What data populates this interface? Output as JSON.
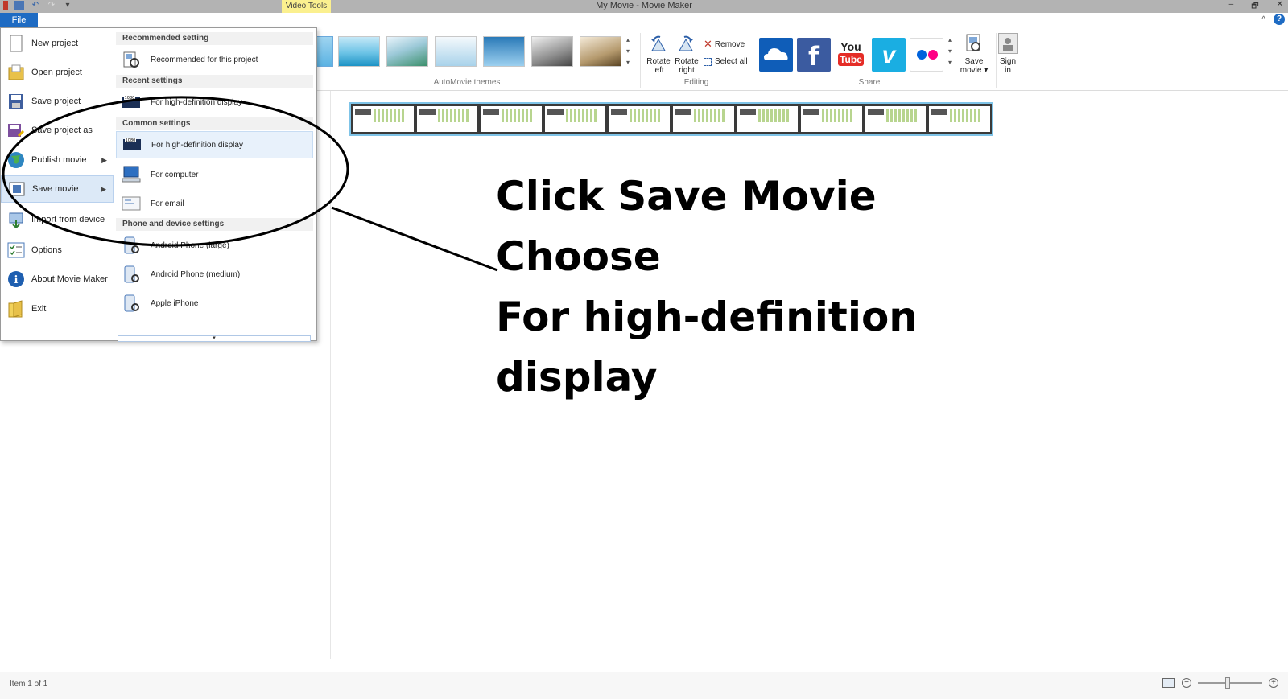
{
  "window": {
    "title": "My Movie - Movie Maker",
    "context_tab": "Video Tools",
    "file_tab": "File",
    "controls": [
      "–",
      "🗗",
      "✕"
    ]
  },
  "ribbon": {
    "groups": {
      "automovie_themes": "AutoMovie themes",
      "editing": "Editing",
      "share": "Share"
    },
    "editing": {
      "rotate_left": "Rotate left",
      "rotate_right": "Rotate right",
      "remove": "Remove",
      "select_all": "Select all"
    },
    "share_services": [
      "OneDrive",
      "Facebook",
      "YouTube",
      "Vimeo",
      "Flickr"
    ],
    "youtube_top": "You",
    "youtube_bottom": "Tube",
    "save_movie": "Save movie",
    "sign_in": "Sign in",
    "colors": {
      "onedrive": "#0f5db8",
      "facebook": "#3b5ba0",
      "youtube": "#e52d27",
      "vimeo": "#1aaee2",
      "flickr_blue": "#0063dc",
      "flickr_pink": "#ff0084"
    }
  },
  "file_menu": {
    "items": [
      {
        "label": "New project",
        "icon": "new-project-icon"
      },
      {
        "label": "Open project",
        "icon": "open-folder-icon"
      },
      {
        "label": "Save project",
        "icon": "save-disk-icon"
      },
      {
        "label": "Save project as",
        "icon": "save-as-icon"
      },
      {
        "label": "Publish movie",
        "icon": "globe-icon"
      },
      {
        "label": "Save movie",
        "icon": "film-icon"
      },
      {
        "label": "Import from device",
        "icon": "import-device-icon"
      },
      {
        "label": "Options",
        "icon": "options-checklist-icon"
      },
      {
        "label": "About Movie Maker",
        "icon": "info-icon"
      },
      {
        "label": "Exit",
        "icon": "exit-folder-icon"
      }
    ],
    "save_submenu": {
      "sections": {
        "recommended": "Recommended setting",
        "recent": "Recent settings",
        "common": "Common settings",
        "phone": "Phone and device settings"
      },
      "options": {
        "recommended": "Recommended for this project",
        "recent_hd": "For high-definition display",
        "hd": "For high-definition display",
        "computer": "For computer",
        "email": "For email",
        "android_large": "Android Phone (large)",
        "android_medium": "Android Phone (medium)",
        "apple_iphone": "Apple iPhone"
      },
      "hd_badge": "1080"
    }
  },
  "instructions": {
    "line1": "Click Save Movie",
    "line2": "Choose",
    "line3": "For high-definition",
    "line4": "display"
  },
  "status": {
    "item_count": "Item 1 of 1"
  }
}
